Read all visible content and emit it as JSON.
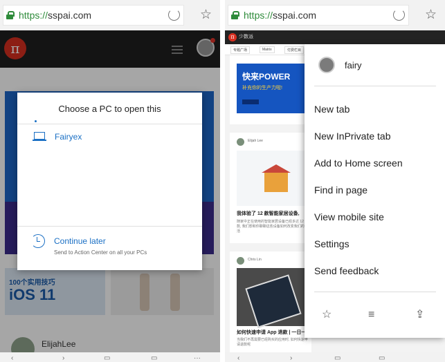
{
  "left_screen": {
    "browser": {
      "url_scheme": "https://",
      "url_host": "sspai.com"
    },
    "page": {
      "logo_glyph": "π",
      "ios_card_line1": "100个实用技巧",
      "ios_card_line2": "iOS 11",
      "author": "ElijahLee"
    },
    "dialog": {
      "title": "Choose a PC to open this",
      "pcs": [
        {
          "name": "Fairyex"
        }
      ],
      "continue_later_title": "Continue later",
      "continue_later_subtitle": "Send to Action Center on all your PCs"
    }
  },
  "right_screen": {
    "browser": {
      "url_scheme": "https://",
      "url_host": "sspai.com"
    },
    "page": {
      "brand": "少数派",
      "tabs": [
        "专题广场",
        "Matrix",
        "付费栏目"
      ],
      "banner_title": "快来POWER",
      "banner_sub": "补充你的生产力啦!",
      "author1": "Elijah Lee",
      "headline1": "我体验了 12 款智能家居设备,",
      "snippet1": "随家中正在使用的智能家居设备已经多达 12 款, 我们想和你聊聊这些设备如何改变我们的生活",
      "author2": "Chris Lin",
      "headline2": "如何快速申请 App 退款 | 一日一",
      "snippet2": "当我们不再需要已经购买的应用时, 如何快速申请退款呢"
    },
    "menu": {
      "user_name": "fairy",
      "items": [
        {
          "label": "New tab"
        },
        {
          "label": "New InPrivate tab"
        },
        {
          "label": "Add to Home screen"
        },
        {
          "label": "Find in page"
        },
        {
          "label": "View mobile site"
        },
        {
          "label": "Settings"
        },
        {
          "label": "Send feedback"
        }
      ],
      "bottom_icons": [
        "favorites-icon",
        "reading-list-icon",
        "share-icon"
      ]
    }
  },
  "colors": {
    "accent": "#1a6fc4",
    "secure_green": "#2e8b3a",
    "brand_red": "#d82f20"
  }
}
